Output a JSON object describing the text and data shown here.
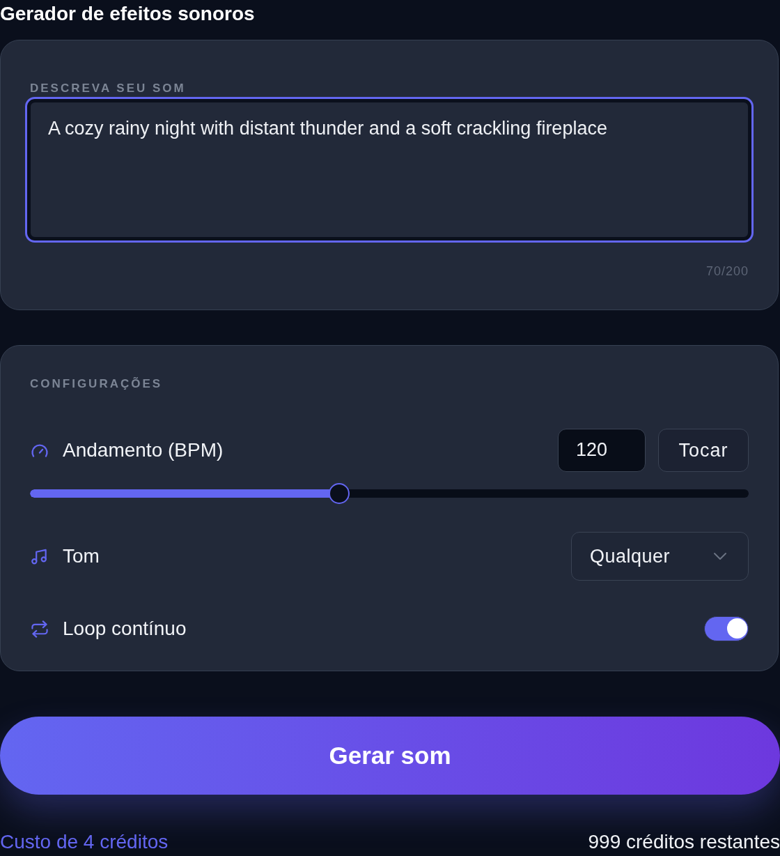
{
  "title": "Gerador de efeitos sonoros",
  "prompt": {
    "label": "DESCREVA SEU SOM",
    "value": "A cozy rainy night with distant thunder and a soft crackling fireplace",
    "focused": true,
    "counter": "70/200"
  },
  "settings": {
    "label": "CONFIGURAÇÕES",
    "rows": [
      {
        "kind": "tempo",
        "label": "Andamento (BPM)",
        "value": "120",
        "button": "Tocar",
        "level": 0.43
      },
      {
        "kind": "select",
        "label": "Tom",
        "value": "Qualquer"
      },
      {
        "kind": "toggle",
        "label": "Loop contínuo",
        "on": true
      }
    ]
  },
  "generate_button": "Gerar som",
  "footer": {
    "cost": "Custo de 4 créditos",
    "remaining": "999 créditos restantes"
  }
}
